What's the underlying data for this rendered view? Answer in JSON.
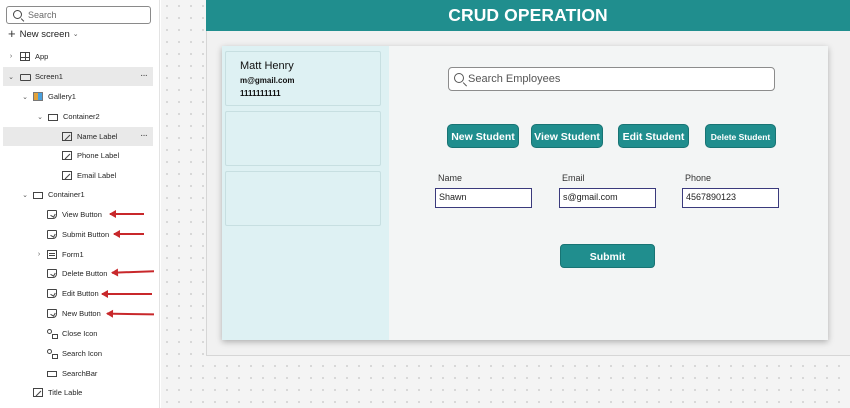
{
  "tree": {
    "search_placeholder": "Search",
    "new_screen_label": "New screen",
    "items": [
      {
        "label": "App",
        "icon": "app-icon"
      },
      {
        "label": "Screen1",
        "icon": "screen-icon",
        "selected": true
      },
      {
        "label": "Gallery1",
        "icon": "gallery-icon"
      },
      {
        "label": "Container2",
        "icon": "container-icon"
      },
      {
        "label": "Name Label",
        "icon": "label-icon",
        "selected": true
      },
      {
        "label": "Phone Label",
        "icon": "label-icon"
      },
      {
        "label": "Email Label",
        "icon": "label-icon"
      },
      {
        "label": "Container1",
        "icon": "container-icon"
      },
      {
        "label": "View Button",
        "icon": "button-icon"
      },
      {
        "label": "Submit Button",
        "icon": "button-icon"
      },
      {
        "label": "Form1",
        "icon": "form-icon"
      },
      {
        "label": "Delete Button",
        "icon": "button-icon"
      },
      {
        "label": "Edit Button",
        "icon": "button-icon"
      },
      {
        "label": "New Button",
        "icon": "button-icon"
      },
      {
        "label": "Close Icon",
        "icon": "icons-icon"
      },
      {
        "label": "Search Icon",
        "icon": "icons-icon"
      },
      {
        "label": "SearchBar",
        "icon": "searchbar-icon"
      },
      {
        "label": "Title Lable",
        "icon": "label-icon"
      }
    ],
    "annotation_color": "#c8282b"
  },
  "app": {
    "title": "CRUD OPERATION",
    "accent": "#208e8e",
    "gallery": {
      "name": "Matt Henry",
      "email": "m@gmail.com",
      "phone": "1111111111"
    },
    "search_placeholder": "Search Employees",
    "buttons": {
      "new": "New Student",
      "view": "View Student",
      "edit": "Edit Student",
      "delete": "Delete Student"
    },
    "form": {
      "name_label": "Name",
      "name_value": "Shawn",
      "email_label": "Email",
      "email_value": "s@gmail.com",
      "phone_label": "Phone",
      "phone_value": "4567890123"
    },
    "submit_label": "Submit"
  }
}
